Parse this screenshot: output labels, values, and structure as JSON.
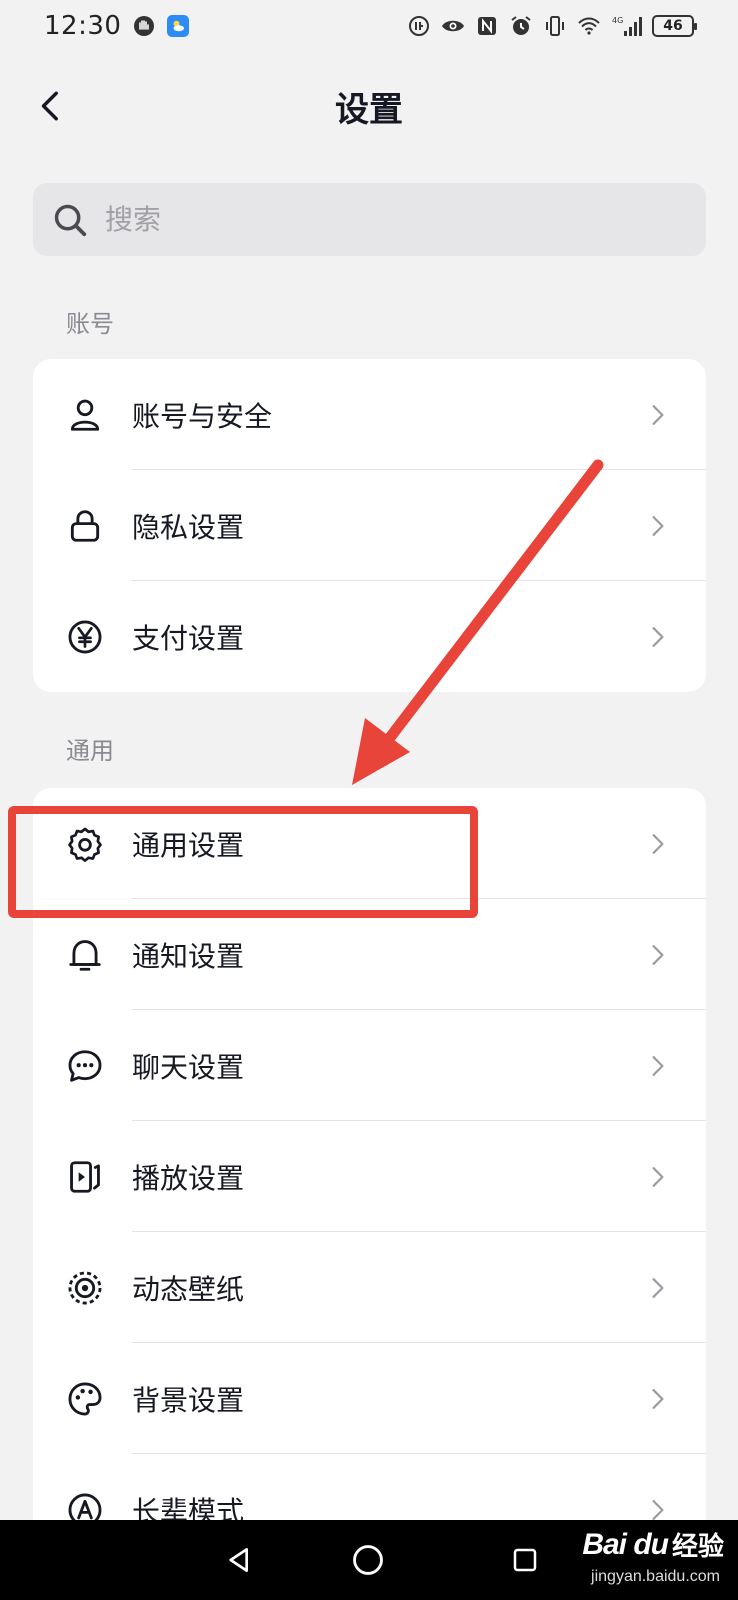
{
  "status_bar": {
    "time": "12:30",
    "battery": "46",
    "network": "4G"
  },
  "header": {
    "title": "设置"
  },
  "search": {
    "placeholder": "搜索"
  },
  "sections": [
    {
      "label": "账号",
      "items": [
        {
          "label": "账号与安全",
          "icon": "user-icon"
        },
        {
          "label": "隐私设置",
          "icon": "lock-icon"
        },
        {
          "label": "支付设置",
          "icon": "yen-icon"
        }
      ]
    },
    {
      "label": "通用",
      "items": [
        {
          "label": "通用设置",
          "icon": "gear-icon"
        },
        {
          "label": "通知设置",
          "icon": "bell-icon"
        },
        {
          "label": "聊天设置",
          "icon": "chat-icon"
        },
        {
          "label": "播放设置",
          "icon": "play-icon"
        },
        {
          "label": "动态壁纸",
          "icon": "wallpaper-icon"
        },
        {
          "label": "背景设置",
          "icon": "palette-icon"
        },
        {
          "label": "长辈模式",
          "icon": "elder-mode-icon"
        }
      ]
    }
  ],
  "watermark": {
    "logo": "Bai du",
    "text": "经验",
    "url": "jingyan.baidu.com"
  },
  "colors": {
    "background": "#f2f2f3",
    "card": "#ffffff",
    "annotation": "#e8443a",
    "text_primary": "#161823",
    "text_secondary": "#8a8b91"
  }
}
